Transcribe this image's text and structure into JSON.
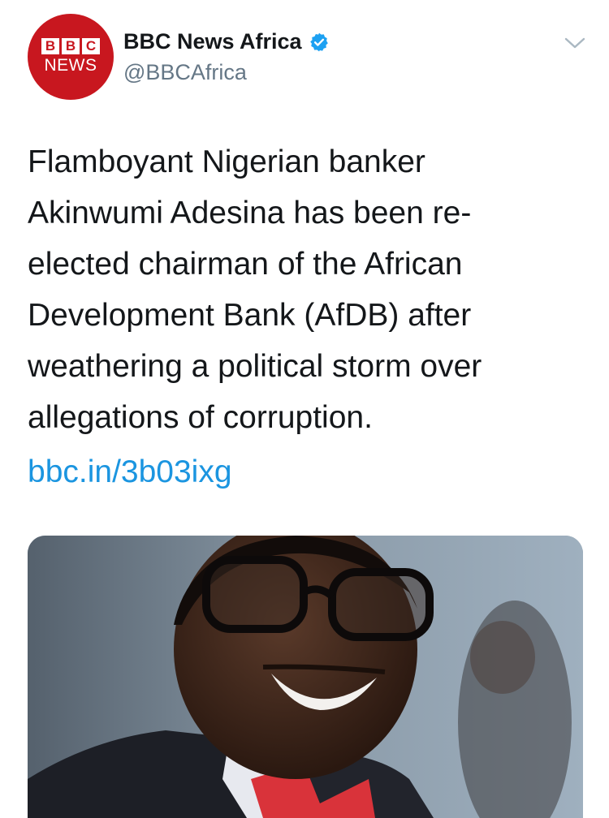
{
  "account": {
    "display_name": "BBC News Africa",
    "handle": "@BBCAfrica",
    "verified": true,
    "avatar": {
      "logo_blocks": [
        "B",
        "B",
        "C"
      ],
      "logo_word": "NEWS",
      "color": "#c8171f"
    }
  },
  "tweet": {
    "text_lines": [
      "Flamboyant Nigerian banker",
      "Akinwumi Adesina has been re-",
      "elected chairman of the African",
      "Development Bank (AfDB) after",
      "weathering a political storm over",
      "allegations of corruption."
    ],
    "link": "bbc.in/3b03ixg"
  },
  "colors": {
    "text": "#14171a",
    "secondary": "#657786",
    "link": "#1b95e0",
    "verified": "#1da1f2"
  },
  "icons": {
    "verified": "verified-badge-icon",
    "caret": "chevron-down-icon"
  },
  "media": {
    "type": "photo"
  }
}
